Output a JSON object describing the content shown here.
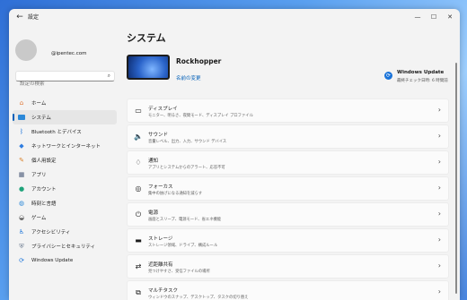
{
  "window": {
    "title": "設定"
  },
  "account": {
    "email": "@ipentec.com"
  },
  "search": {
    "placeholder": "設定の検索"
  },
  "sidebar": {
    "items": [
      {
        "label": "ホーム",
        "icon": "home-icon"
      },
      {
        "label": "システム",
        "icon": "system-icon",
        "active": true
      },
      {
        "label": "Bluetooth とデバイス",
        "icon": "bluetooth-icon"
      },
      {
        "label": "ネットワークとインターネット",
        "icon": "network-icon"
      },
      {
        "label": "個人用設定",
        "icon": "brush-icon"
      },
      {
        "label": "アプリ",
        "icon": "apps-icon"
      },
      {
        "label": "アカウント",
        "icon": "account-icon"
      },
      {
        "label": "時刻と言語",
        "icon": "globe-icon"
      },
      {
        "label": "ゲーム",
        "icon": "gamepad-icon"
      },
      {
        "label": "アクセシビリティ",
        "icon": "accessibility-icon"
      },
      {
        "label": "プライバシーとセキュリティ",
        "icon": "shield-icon"
      },
      {
        "label": "Windows Update",
        "icon": "windows-update-icon"
      }
    ]
  },
  "main": {
    "title": "システム",
    "device": {
      "name": "Rockhopper",
      "rename_label": "名前の変更"
    },
    "windows_update": {
      "title": "Windows Update",
      "subtitle": "最終チェック日時: 6 時間前"
    },
    "cards": [
      {
        "title": "ディスプレイ",
        "subtitle": "モニター、明るさ、夜間モード、ディスプレイ プロファイル",
        "icon": "display-icon"
      },
      {
        "title": "サウンド",
        "subtitle": "音量レベル、出力、入力、サウンド デバイス",
        "icon": "speaker-icon"
      },
      {
        "title": "通知",
        "subtitle": "アプリとシステムからのアラート、応答不可",
        "icon": "bell-icon"
      },
      {
        "title": "フォーカス",
        "subtitle": "集中の妨げになる通知を減らす",
        "icon": "focus-icon"
      },
      {
        "title": "電源",
        "subtitle": "画面とスリープ、電源モード、省エネ機能",
        "icon": "power-icon"
      },
      {
        "title": "ストレージ",
        "subtitle": "ストレージ領域、ドライブ、構成ルール",
        "icon": "storage-icon"
      },
      {
        "title": "近距離共有",
        "subtitle": "見つけやすさ、受信ファイルの場所",
        "icon": "nearby-share-icon"
      },
      {
        "title": "マルチタスク",
        "subtitle": "ウィンドウのスナップ、デスクトップ、タスクの切り替え",
        "icon": "multitask-icon"
      }
    ]
  },
  "colors": {
    "accent": "#005fb8",
    "window_bg": "#f3f3f3",
    "card_bg": "#fbfbfb"
  }
}
